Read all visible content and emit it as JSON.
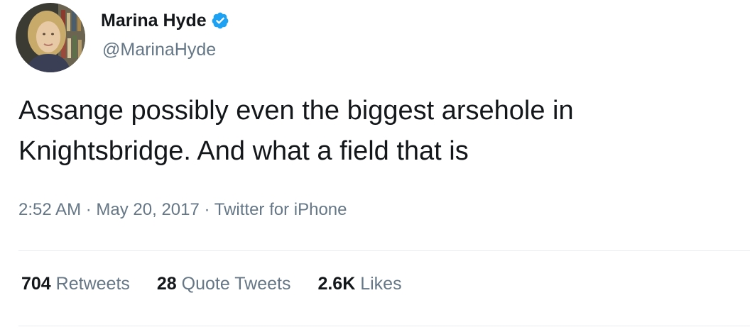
{
  "author": {
    "display_name": "Marina Hyde",
    "handle": "@MarinaHyde",
    "verified": true,
    "verified_icon": "verified-badge-icon",
    "verified_color": "#1da1f2"
  },
  "tweet": {
    "text": "Assange possibly even the biggest arsehole in Knightsbridge. And what a field that is",
    "time": "2:52 AM",
    "separator": "·",
    "date": "May 20, 2017",
    "source": "Twitter for iPhone"
  },
  "stats": {
    "retweets": {
      "count": "704",
      "label": "Retweets"
    },
    "quote_tweets": {
      "count": "28",
      "label": "Quote Tweets"
    },
    "likes": {
      "count": "2.6K",
      "label": "Likes"
    }
  },
  "colors": {
    "text": "#14171a",
    "secondary": "#657786",
    "divider": "#e6ecf0"
  }
}
